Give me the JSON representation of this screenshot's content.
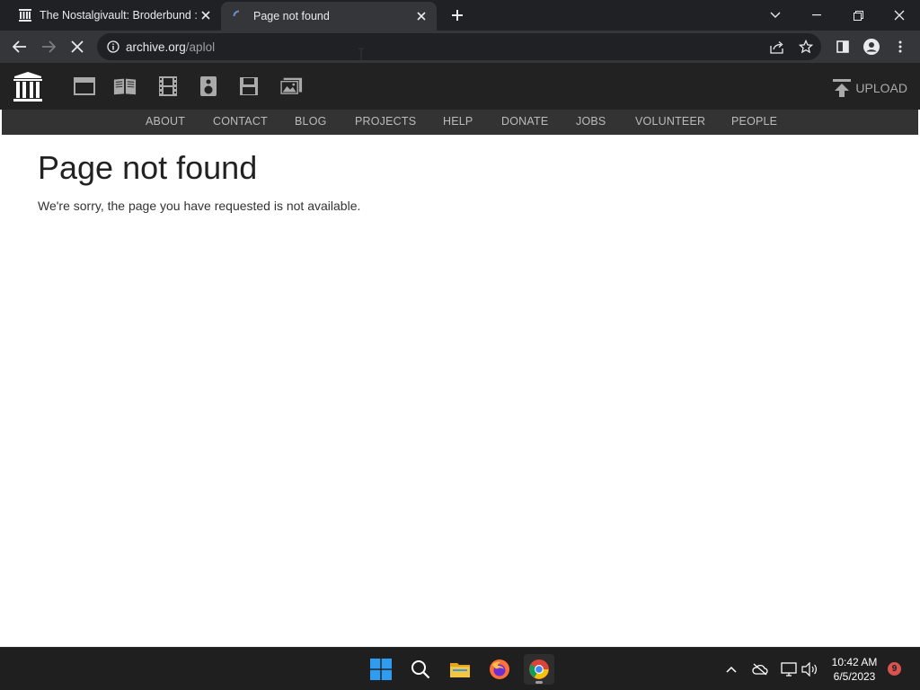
{
  "tabs": [
    {
      "title": "The Nostalgivault: Broderbund : B",
      "favicon": "archive-org-icon",
      "active": false
    },
    {
      "title": "Page not found",
      "favicon": "loading-spinner-icon",
      "active": true
    }
  ],
  "toolbar": {
    "url_host": "archive.org",
    "url_path": "/aplol"
  },
  "ia_header": {
    "media_icons": [
      "web-icon",
      "texts-icon",
      "video-icon",
      "audio-icon",
      "software-icon",
      "images-icon"
    ],
    "upload_label": "UPLOAD",
    "nav": [
      "ABOUT",
      "CONTACT",
      "BLOG",
      "PROJECTS",
      "HELP",
      "DONATE",
      "JOBS",
      "VOLUNTEER",
      "PEOPLE"
    ]
  },
  "content": {
    "title": "Page not found",
    "message": "We're sorry, the page you have requested is not available."
  },
  "taskbar": {
    "apps": [
      "windows-start-icon",
      "search-icon",
      "file-explorer-icon",
      "firefox-icon",
      "chrome-icon"
    ],
    "time": "10:42 AM",
    "date": "6/5/2023",
    "notification_count": "9"
  },
  "colors": {
    "tabstrip": "#202124",
    "toolbar": "#35363a",
    "ia_header": "#222222",
    "ia_nav": "#333333",
    "taskbar": "#1f1f1f",
    "windows_blue": "#2f9cf0"
  }
}
